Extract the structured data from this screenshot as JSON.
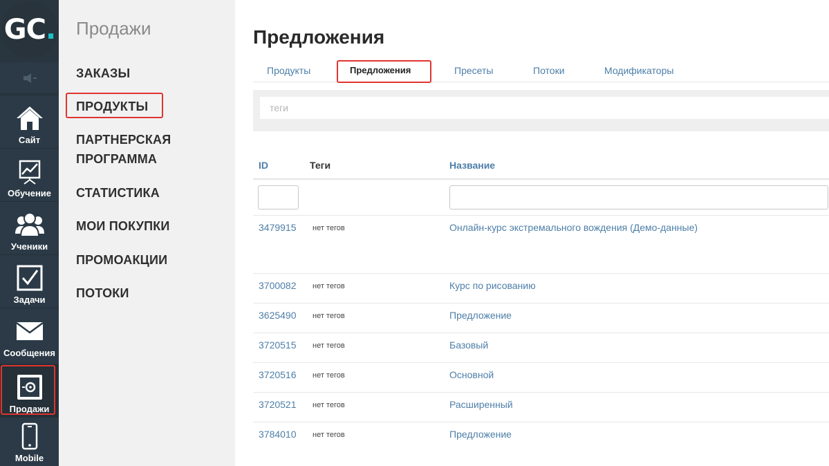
{
  "brand": {
    "logo_main": "GC",
    "logo_dot": "."
  },
  "sidebar": {
    "items": [
      {
        "label": "Сайт",
        "icon": "home-icon"
      },
      {
        "label": "Обучение",
        "icon": "chart-board-icon"
      },
      {
        "label": "Ученики",
        "icon": "users-icon"
      },
      {
        "label": "Задачи",
        "icon": "checkbox-icon"
      },
      {
        "label": "Сообщения",
        "icon": "envelope-icon"
      },
      {
        "label": "Продажи",
        "icon": "safe-icon",
        "active": true
      },
      {
        "label": "Mobile",
        "icon": "phone-icon"
      }
    ]
  },
  "menu": {
    "title": "Продажи",
    "items": [
      {
        "label": "ЗАКАЗЫ"
      },
      {
        "label": "ПРОДУКТЫ",
        "highlighted": true
      },
      {
        "label": "ПАРТНЕРСКАЯ ПРОГРАММА"
      },
      {
        "label": "СТАТИСТИКА"
      },
      {
        "label": "МОИ ПОКУПКИ"
      },
      {
        "label": "ПРОМОАКЦИИ"
      },
      {
        "label": "ПОТОКИ"
      }
    ]
  },
  "page": {
    "title": "Предложения",
    "tabs": [
      {
        "label": "Продукты"
      },
      {
        "label": "Предложения",
        "active": true
      },
      {
        "label": "Пресеты"
      },
      {
        "label": "Потоки"
      },
      {
        "label": "Модификаторы"
      }
    ],
    "tags_placeholder": "теги"
  },
  "table": {
    "headers": {
      "id": "ID",
      "tags": "Теги",
      "name": "Название"
    },
    "rows": [
      {
        "id": "3479915",
        "tags": "нет тегов",
        "name": "Онлайн-курс экстремального вождения (Демо-данные)"
      },
      {
        "id": "3700082",
        "tags": "нет тегов",
        "name": "Курс по рисованию"
      },
      {
        "id": "3625490",
        "tags": "нет тегов",
        "name": "Предложение"
      },
      {
        "id": "3720515",
        "tags": "нет тегов",
        "name": "Базовый"
      },
      {
        "id": "3720516",
        "tags": "нет тегов",
        "name": "Основной"
      },
      {
        "id": "3720521",
        "tags": "нет тегов",
        "name": "Расширенный"
      },
      {
        "id": "3784010",
        "tags": "нет тегов",
        "name": "Предложение"
      }
    ]
  },
  "colors": {
    "sidebar_bg": "#2b3a46",
    "menu_bg": "#f1f1f1",
    "link_blue": "#4d7ea8",
    "highlight_red": "#e0342f",
    "logo_accent": "#19c3c9"
  }
}
